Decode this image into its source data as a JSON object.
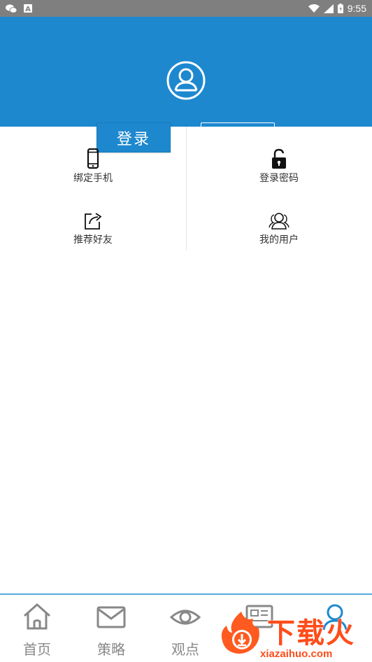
{
  "status_bar": {
    "time": "9:55",
    "icons": [
      "wechat-icon",
      "a-badge-icon",
      "wifi-icon",
      "signal-icon",
      "battery-icon"
    ]
  },
  "header": {
    "bg_color": "#1e88cf",
    "avatar_icon": "user-avatar-icon"
  },
  "auth": {
    "login_label": "登录"
  },
  "menu": {
    "items": [
      {
        "label": "绑定手机",
        "icon": "phone-icon"
      },
      {
        "label": "登录密码",
        "icon": "lock-icon"
      },
      {
        "label": "推荐好友",
        "icon": "share-icon"
      },
      {
        "label": "我的用户",
        "icon": "users-icon"
      }
    ]
  },
  "bottom_nav": {
    "accent": "#1e88cf",
    "items": [
      {
        "label": "首页",
        "icon": "home-icon"
      },
      {
        "label": "策略",
        "icon": "mail-icon"
      },
      {
        "label": "观点",
        "icon": "eye-icon"
      },
      {
        "label": "",
        "icon": "news-icon"
      },
      {
        "label": "",
        "icon": "user-icon"
      }
    ]
  },
  "watermark": {
    "brand": "下载火",
    "url": "xiazaihuo.com"
  }
}
